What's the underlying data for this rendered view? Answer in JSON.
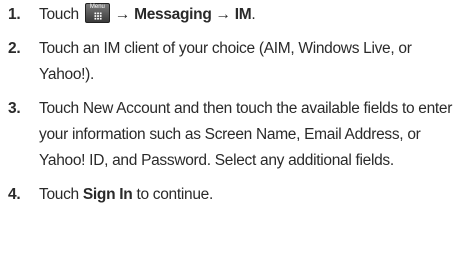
{
  "steps": [
    {
      "number": "1.",
      "prefix": "Touch",
      "menu_key_label": "Menu",
      "path": "→ Messaging → IM",
      "suffix": "."
    },
    {
      "number": "2.",
      "text": "Touch an IM client of your choice (AIM, Windows Live, or Yahoo!)."
    },
    {
      "number": "3.",
      "text": "Touch New Account and then touch the available fields to enter your information such as Screen Name, Email Address, or Yahoo! ID, and Password. Select any additional fields."
    },
    {
      "number": "4.",
      "prefix": "Touch ",
      "bold": "Sign In",
      "suffix": " to continue."
    }
  ]
}
